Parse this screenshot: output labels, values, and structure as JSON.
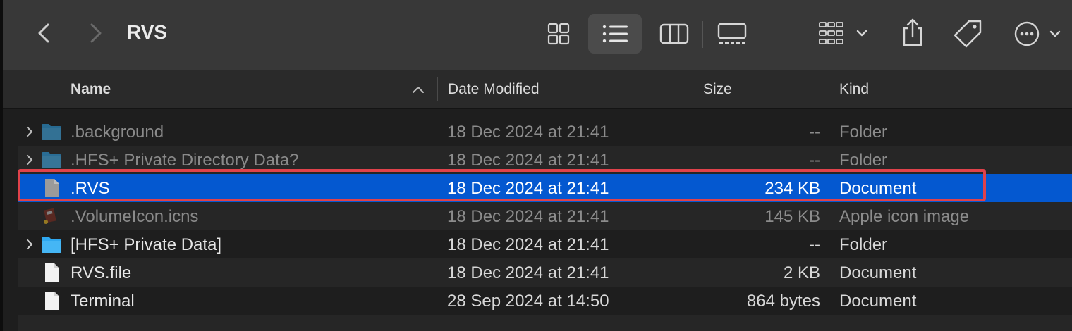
{
  "window": {
    "title": "RVS"
  },
  "toolbar": {
    "back_icon": "chevron-left-icon",
    "forward_icon": "chevron-right-icon",
    "views": [
      "icon-view-icon",
      "list-view-icon",
      "column-view-icon",
      "gallery-view-icon"
    ],
    "active_view": "list-view-icon",
    "actions": [
      "group-by-icon",
      "share-icon",
      "tag-icon",
      "more-actions-icon"
    ]
  },
  "columns": {
    "name": "Name",
    "date": "Date Modified",
    "size": "Size",
    "kind": "Kind",
    "sort_icon": "chevron-up-icon"
  },
  "files": [
    {
      "name": ".background",
      "date": "18 Dec 2024 at 21:41",
      "size": "--",
      "kind": "Folder",
      "icon": "folder-icon",
      "expandable": true,
      "hidden": true
    },
    {
      "name": ".HFS+ Private Directory Data?",
      "date": "18 Dec 2024 at 21:41",
      "size": "--",
      "kind": "Folder",
      "icon": "folder-icon",
      "expandable": true,
      "hidden": true
    },
    {
      "name": ".RVS",
      "date": "18 Dec 2024 at 21:41",
      "size": "234 KB",
      "kind": "Document",
      "icon": "document-icon",
      "expandable": false,
      "hidden": true,
      "selected": true
    },
    {
      "name": ".VolumeIcon.icns",
      "date": "18 Dec 2024 at 21:41",
      "size": "145 KB",
      "kind": "Apple icon image",
      "icon": "icns-image-icon",
      "expandable": false,
      "hidden": true
    },
    {
      "name": "[HFS+ Private Data]",
      "date": "18 Dec 2024 at 21:41",
      "size": "--",
      "kind": "Folder",
      "icon": "folder-icon",
      "expandable": true,
      "hidden": false
    },
    {
      "name": "RVS.file",
      "date": "18 Dec 2024 at 21:41",
      "size": "2 KB",
      "kind": "Document",
      "icon": "document-icon",
      "expandable": false,
      "hidden": false
    },
    {
      "name": "Terminal",
      "date": "28 Sep 2024 at 14:50",
      "size": "864 bytes",
      "kind": "Document",
      "icon": "document-icon",
      "expandable": false,
      "hidden": false
    }
  ],
  "colors": {
    "selection": "#0458d0",
    "highlight_border": "#e0424b",
    "folder": "#2fa8f0"
  }
}
